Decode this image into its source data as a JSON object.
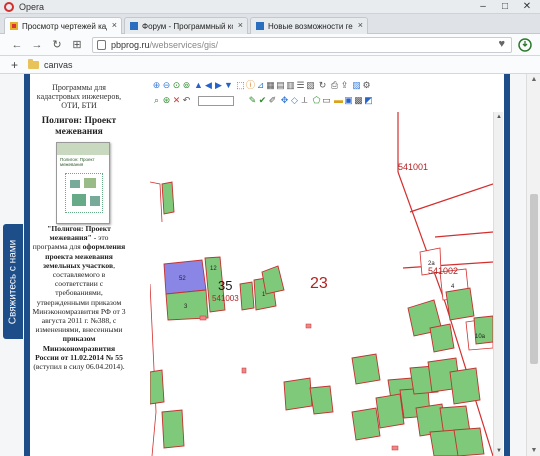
{
  "window": {
    "title": "Opera",
    "minimize_icon": "minimize-icon",
    "maximize_icon": "maximize-icon",
    "close_icon": "close-icon"
  },
  "tabs": [
    {
      "label": "Просмотр чертежей кадастров",
      "active": true
    },
    {
      "label": "Форум - Программный ко",
      "active": false
    },
    {
      "label": "Новые возможности гео",
      "active": false
    }
  ],
  "nav": {
    "url_host": "pbprog.ru",
    "url_path": "/webservices/gis/"
  },
  "bookmarks": [
    {
      "label": "canvas"
    }
  ],
  "contact_tab": {
    "label": "Свяжитесь с нами"
  },
  "sidebar": {
    "intro": "Программы для кадастровых инженеров, ОТИ, БТИ",
    "product_title": "Полигон: Проект межевания",
    "cover_title": "Полигон: Проект межевания",
    "desc_b1": "\"Полигон: Проект межевания\"",
    "desc_t1": " - это программа для ",
    "desc_b2": "оформления проекта межевания земельных участков",
    "desc_t2": ", составляемого в соответствии с требованиями, утвержденными приказом Минэкономразвития РФ от 3 августа 2011 г. №388, с изменениями, внесенными ",
    "desc_b3": "приказом Минэкономразвития России от 11.02.2014 № 55",
    "desc_t3": " (вступил в силу 06.04.2014)."
  },
  "map": {
    "labels": {
      "q541001": "541001",
      "q541002": "541002",
      "q541003": "541003",
      "n23": "23",
      "n35": "35",
      "p52": "52",
      "p3": "3",
      "p12": "12",
      "p1": "1",
      "p2a": "2а",
      "p4": "4",
      "p10a": "10а"
    },
    "colors": {
      "parcel_fill": "#7fc97a",
      "parcel_stroke": "#c53030",
      "selected_fill": "#8a86e6",
      "boundary": "#d32f2f"
    }
  }
}
